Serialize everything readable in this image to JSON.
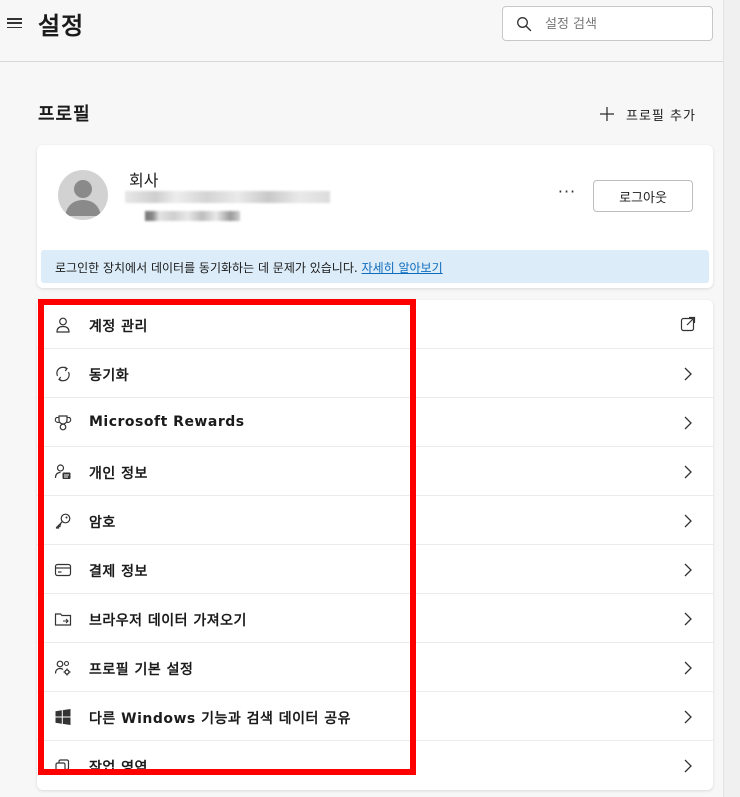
{
  "header": {
    "menu_icon": "hamburger-icon",
    "title": "설정",
    "search": {
      "placeholder": "설정 검색",
      "icon": "search-icon"
    }
  },
  "profile_section": {
    "title": "프로필",
    "add_profile_label": "프로필 추가",
    "profile": {
      "name": "회사",
      "avatar_icon": "person-avatar-icon",
      "more_label": "···",
      "logout_label": "로그아웃"
    },
    "sync_notice": {
      "text": "로그인한 장치에서 데이터를 동기화하는 데 문제가 있습니다.",
      "link": "자세히 알아보기"
    }
  },
  "menu": [
    {
      "label": "계정 관리",
      "icon": "person-icon",
      "trailing": "external-link-icon"
    },
    {
      "label": "동기화",
      "icon": "sync-icon",
      "trailing": "chevron-right-icon"
    },
    {
      "label": "Microsoft Rewards",
      "icon": "trophy-icon",
      "trailing": "chevron-right-icon"
    },
    {
      "label": "개인 정보",
      "icon": "person-card-icon",
      "trailing": "chevron-right-icon"
    },
    {
      "label": "암호",
      "icon": "key-icon",
      "trailing": "chevron-right-icon"
    },
    {
      "label": "결제 정보",
      "icon": "credit-card-icon",
      "trailing": "chevron-right-icon"
    },
    {
      "label": "브라우저 데이터 가져오기",
      "icon": "folder-import-icon",
      "trailing": "chevron-right-icon"
    },
    {
      "label": "프로필 기본 설정",
      "icon": "people-settings-icon",
      "trailing": "chevron-right-icon"
    },
    {
      "label": "다른 Windows 기능과 검색 데이터 공유",
      "icon": "windows-logo-icon",
      "trailing": "chevron-right-icon"
    },
    {
      "label": "작업 영역",
      "icon": "workspaces-icon",
      "trailing": "chevron-right-icon"
    }
  ],
  "colors": {
    "highlight": "#ff0000",
    "link": "#0f6cbd",
    "notice_bg": "#dcecf8",
    "page_bg": "#f7f7f7"
  }
}
